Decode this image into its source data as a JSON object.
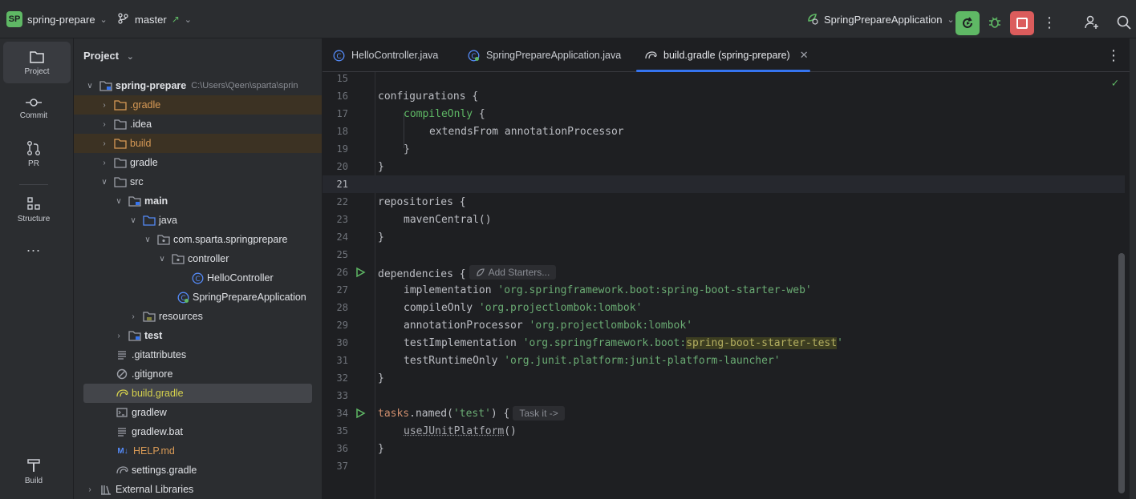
{
  "topbar": {
    "project_badge": "SP",
    "project_name": "spring-prepare",
    "branch": "master",
    "run_config": "SpringPrepareApplication"
  },
  "left_toolbar": {
    "items": [
      {
        "label": "Project"
      },
      {
        "label": "Commit"
      },
      {
        "label": "PR"
      },
      {
        "label": "Structure"
      },
      {
        "label": "..."
      },
      {
        "label": "Build"
      }
    ]
  },
  "project_panel": {
    "title": "Project",
    "root_path": "C:\\Users\\Qeen\\sparta\\sprin",
    "tree": [
      {
        "label": "spring-prepare"
      },
      {
        "label": ".gradle"
      },
      {
        "label": ".idea"
      },
      {
        "label": "build"
      },
      {
        "label": "gradle"
      },
      {
        "label": "src"
      },
      {
        "label": "main"
      },
      {
        "label": "java"
      },
      {
        "label": "com.sparta.springprepare"
      },
      {
        "label": "controller"
      },
      {
        "label": "HelloController"
      },
      {
        "label": "SpringPrepareApplication"
      },
      {
        "label": "resources"
      },
      {
        "label": "test"
      },
      {
        "label": ".gitattributes"
      },
      {
        "label": ".gitignore"
      },
      {
        "label": "build.gradle"
      },
      {
        "label": "gradlew"
      },
      {
        "label": "gradlew.bat"
      },
      {
        "label": "HELP.md"
      },
      {
        "label": "settings.gradle"
      },
      {
        "label": "External Libraries"
      }
    ]
  },
  "tabs": [
    {
      "label": "HelloController.java"
    },
    {
      "label": "SpringPrepareApplication.java"
    },
    {
      "label": "build.gradle (spring-prepare)"
    }
  ],
  "editor": {
    "line_numbers": [
      "15",
      "16",
      "17",
      "18",
      "19",
      "20",
      "21",
      "22",
      "23",
      "24",
      "25",
      "26",
      "27",
      "28",
      "29",
      "30",
      "31",
      "32",
      "33",
      "34",
      "35",
      "36",
      "37"
    ],
    "code": {
      "l16": "configurations {",
      "l17_kw": "compileOnly",
      "l17_rest": " {",
      "l18": "extendsFrom annotationProcessor",
      "l19": "}",
      "l20": "}",
      "l22": "repositories {",
      "l23": "mavenCentral()",
      "l24": "}",
      "l26": "dependencies {",
      "l26_inlay": "Add Starters...",
      "l27_a": "implementation ",
      "l27_b": "'org.springframework.boot:spring-boot-starter-web'",
      "l28_a": "compileOnly ",
      "l28_b": "'org.projectlombok:lombok'",
      "l29_a": "annotationProcessor ",
      "l29_b": "'org.projectlombok:lombok'",
      "l30_a": "testImplementation ",
      "l30_b": "'org.springframework.boot:",
      "l30_c": "spring-boot-starter-test",
      "l30_d": "'",
      "l31_a": "testRuntimeOnly ",
      "l31_b": "'org.junit.platform:junit-platform-launcher'",
      "l32": "}",
      "l34_a": "tasks",
      "l34_b": ".named(",
      "l34_c": "'test'",
      "l34_d": ") {",
      "l34_inlay": "Task it ->",
      "l35_a": "useJUnitPlatform",
      "l35_b": "()",
      "l36": "}"
    }
  },
  "colors": {
    "accent_blue": "#3574f0",
    "run_green": "#5fb865",
    "stop_red": "#db5c5c"
  }
}
